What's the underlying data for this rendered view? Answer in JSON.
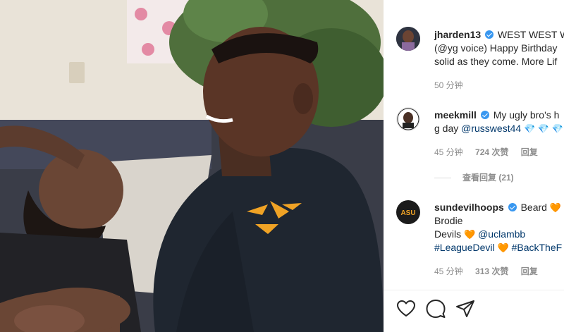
{
  "comments": [
    {
      "username": "jharden13",
      "line1": "WEST WEST W",
      "line2": "(@yg voice) Happy Birthday",
      "line3": "solid as they come. More Lif",
      "time": "50 分钟"
    },
    {
      "username": "meekmill",
      "line1": "My ugly bro's h",
      "line2_prefix": "g day ",
      "mention": "@russwest44",
      "emoji": "💎 💎 💎",
      "time": "45 分钟",
      "likes": "724 次赞",
      "reply": "回复",
      "view_replies": "查看回复 (21)"
    },
    {
      "username": "sundevilhoops",
      "line1": "Beard",
      "line2": "Brodie",
      "line3_prefix": "Devils",
      "mention": "@uclambb",
      "hashtag1": "#LeagueDevil",
      "hashtag2": "#BackTheF",
      "emoji": "🧡",
      "time": "45 分钟",
      "likes": "313 次赞",
      "reply": "回复"
    }
  ],
  "actions": {
    "like": "heart-icon",
    "comment": "comment-icon",
    "share": "share-icon"
  },
  "colors": {
    "verified": "#3897f0",
    "link": "#00376b",
    "meta": "#8e8e8e"
  }
}
